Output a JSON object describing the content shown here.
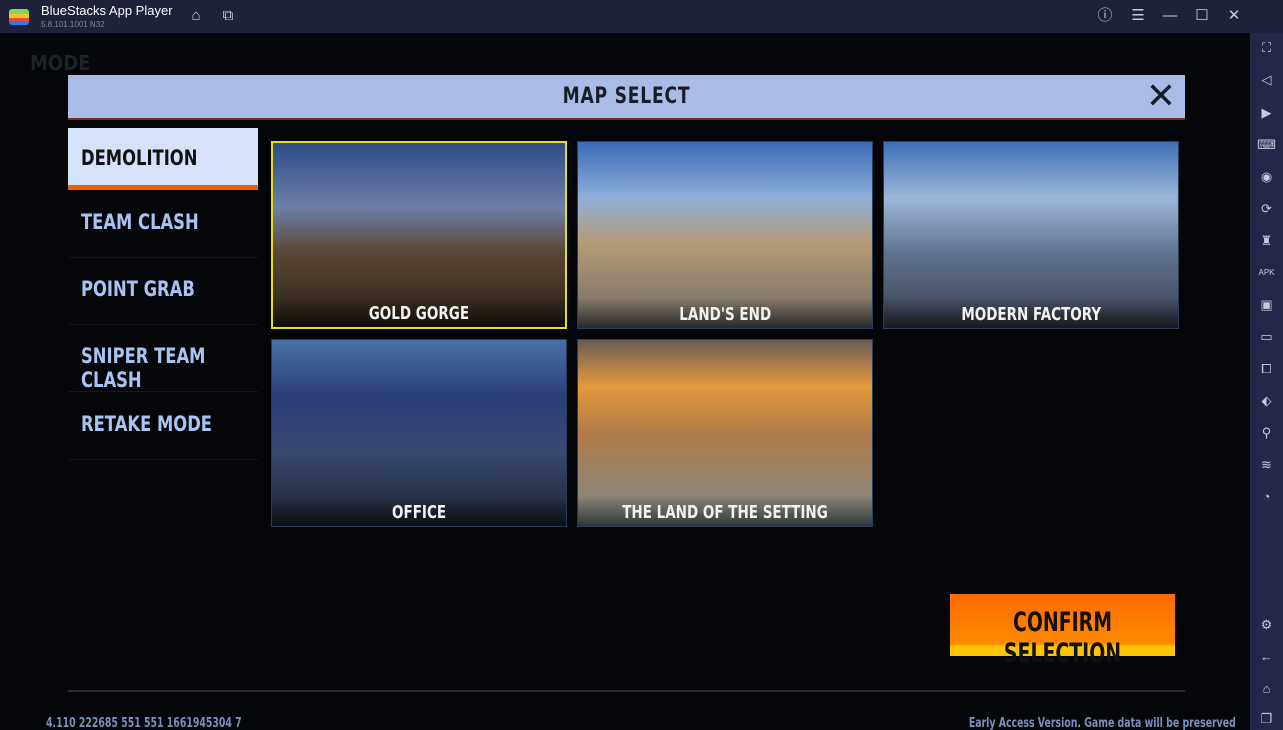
{
  "window": {
    "title": "BlueStacks App Player",
    "version": "5.8.101.1001 N32",
    "icons": [
      "home-icon",
      "multi-instance-icon",
      "help-icon",
      "menu-icon",
      "minimize-icon",
      "maximize-icon",
      "close-icon"
    ]
  },
  "sidebar": {
    "icons": [
      "fullscreen-icon",
      "volume-mute-icon",
      "pointer-icon",
      "keyboard-icon",
      "record-icon",
      "rotate-sync-icon",
      "macro-icon",
      "apk-icon",
      "screenshot-icon",
      "folder-icon",
      "multi-screen-icon",
      "shake-icon",
      "location-icon",
      "layers-icon",
      "eco-mode-icon",
      "settings-icon",
      "back-icon",
      "home-icon",
      "recent-apps-icon"
    ]
  },
  "game": {
    "background_label": "MODE",
    "modal": {
      "title": "MAP SELECT",
      "modes": [
        {
          "label": "DEMOLITION",
          "selected": true
        },
        {
          "label": "TEAM CLASH"
        },
        {
          "label": "POINT GRAB"
        },
        {
          "label": "SNIPER TEAM CLASH"
        },
        {
          "label": "RETAKE MODE"
        }
      ],
      "maps": [
        {
          "label": "GOLD GORGE",
          "selected": true
        },
        {
          "label": "LAND'S END"
        },
        {
          "label": "MODERN FACTORY"
        },
        {
          "label": "OFFICE"
        },
        {
          "label": "THE LAND OF THE SETTING SUN"
        }
      ],
      "confirm_label": "CONFIRM SELECTION"
    },
    "footer_left": "4.110 222685 551 551 1661945304 7",
    "footer_right": "Early Access Version. Game data will be preserved"
  },
  "colors": {
    "accent": "#ff6a00",
    "header": "#a9bce6",
    "selection": "#e5e01a"
  }
}
